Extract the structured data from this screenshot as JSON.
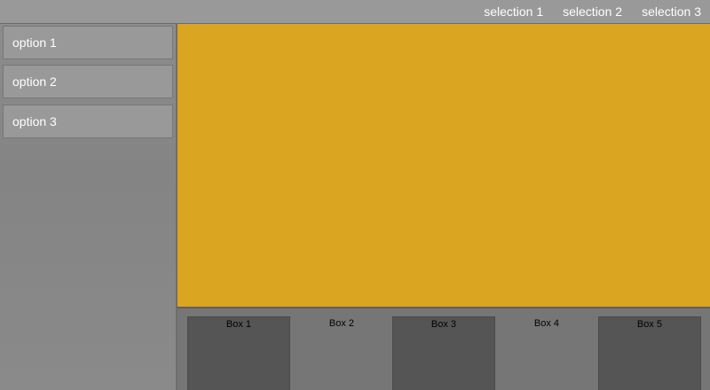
{
  "topnav": {
    "items": [
      {
        "label": "selection 1"
      },
      {
        "label": "selection 2"
      },
      {
        "label": "selection 3"
      }
    ]
  },
  "sidebar": {
    "items": [
      {
        "label": "option 1"
      },
      {
        "label": "option 2"
      },
      {
        "label": "option 3"
      }
    ]
  },
  "main": {
    "accent_color": "#daa520"
  },
  "boxes": [
    {
      "label": "Box 1",
      "style": "dark"
    },
    {
      "label": "Box 2",
      "style": "light"
    },
    {
      "label": "Box 3",
      "style": "dark"
    },
    {
      "label": "Box 4",
      "style": "light"
    },
    {
      "label": "Box 5",
      "style": "dark"
    }
  ]
}
